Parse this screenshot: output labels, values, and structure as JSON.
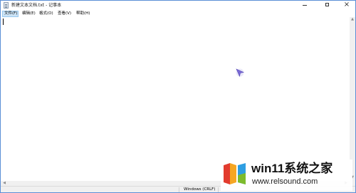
{
  "window": {
    "title": "新建文本文档.txt - 记事本"
  },
  "caption_buttons": {
    "close_glyph": "×"
  },
  "menu": {
    "items": [
      {
        "label": "文件(F)",
        "active": true
      },
      {
        "label": "编辑(E)"
      },
      {
        "label": "格式(O)"
      },
      {
        "label": "查看(V)"
      },
      {
        "label": "帮助(H)"
      }
    ]
  },
  "editor": {
    "content": ""
  },
  "scrollbar": {
    "left_arrow": "◀",
    "right_arrow": "▶",
    "up_arrow": "▲",
    "down_arrow": "▼"
  },
  "status": {
    "encoding": "Windows (CRLF)"
  },
  "watermark": {
    "title": "win11系统之家",
    "url": "www.relsound.com",
    "colors": [
      "#e23b2e",
      "#f5a623",
      "#2e9ee2",
      "#7dbb2c"
    ]
  },
  "colors": {
    "window_border": "#5b8fd6",
    "menu_active_bg": "#cce4f7",
    "cursor": "#7b6ad6"
  }
}
